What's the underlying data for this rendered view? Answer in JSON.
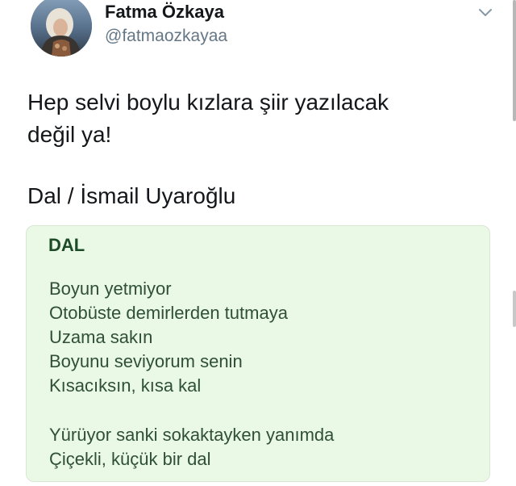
{
  "tweet": {
    "author": {
      "display_name": "Fatma Özkaya",
      "username": "@fatmaozkayaa"
    },
    "text_lines": [
      "Hep selvi boylu kızlara şiir yazılacak",
      "değil ya!"
    ],
    "attribution": "Dal / İsmail Uyaroğlu",
    "poem": {
      "title": "DAL",
      "stanzas": [
        [
          "Boyun yetmiyor",
          "Otobüste demirlerden tutmaya",
          "Uzama sakın",
          "Boyunu seviyorum senin",
          "Kısacıksın, kısa kal"
        ],
        [
          "Yürüyor sanki sokaktayken yanımda",
          "Çiçekli, küçük bir dal"
        ]
      ]
    }
  },
  "icons": {
    "avatar": "profile-photo",
    "menu": "chevron-down-icon"
  },
  "colors": {
    "text": "#14171a",
    "secondary_text": "#657786",
    "poem_background": "#eaf8e6",
    "poem_title": "#1d4a27",
    "poem_text": "#2f4f36"
  }
}
